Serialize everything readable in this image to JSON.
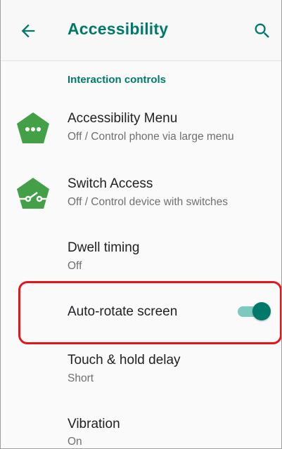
{
  "header": {
    "title": "Accessibility",
    "back_icon": "arrow-back-icon",
    "search_icon": "search-icon"
  },
  "section": {
    "title": "Interaction controls"
  },
  "items": [
    {
      "title": "Accessibility Menu",
      "subtitle": "Off / Control phone via large menu",
      "icon": "accessibility-menu-icon"
    },
    {
      "title": "Switch Access",
      "subtitle": "Off / Control device with switches",
      "icon": "switch-access-icon"
    },
    {
      "title": "Dwell timing",
      "subtitle": "Off"
    },
    {
      "title": "Auto-rotate screen",
      "toggle_on": true
    },
    {
      "title": "Touch & hold delay",
      "subtitle": "Short"
    },
    {
      "title": "Vibration",
      "subtitle": "On"
    }
  ],
  "colors": {
    "accent": "#00796b",
    "icon_green": "#43a047",
    "highlight_red": "#e8141b"
  }
}
